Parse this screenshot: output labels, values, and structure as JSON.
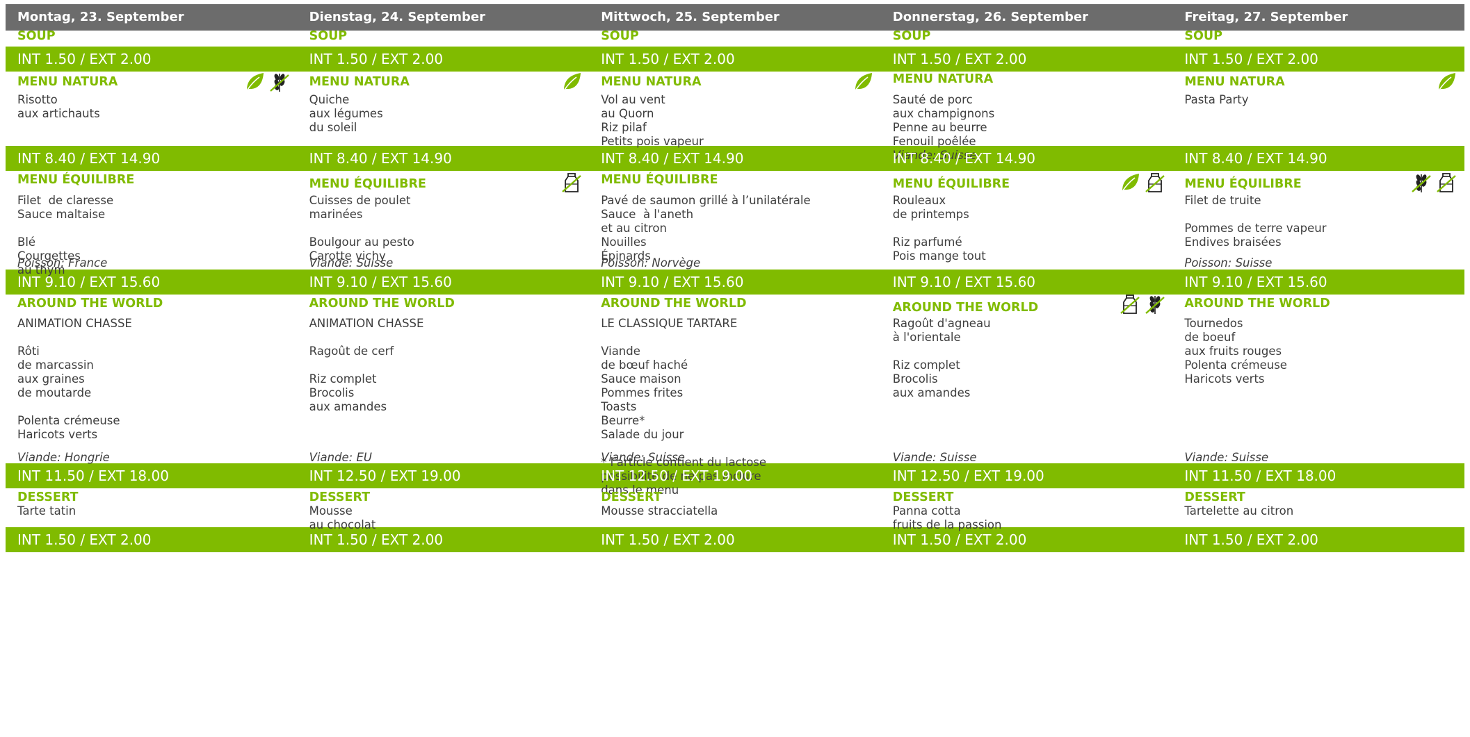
{
  "days": [
    {
      "header": "Montag, 23. September",
      "soup": {
        "title": "SOUP",
        "price": "INT 1.50 / EXT 2.00"
      },
      "natura": {
        "title": "MENU NATURA",
        "lines": [
          "Risotto",
          "aux artichauts"
        ],
        "origin": "",
        "price": "INT 8.40 / EXT 14.90",
        "icons": [
          "leaf-icon",
          "gluten-free-icon"
        ]
      },
      "equilibre": {
        "title": "MENU ÉQUILIBRE",
        "lines": [
          "Filet  de claresse",
          "Sauce maltaise",
          "",
          "Blé",
          "Courgettes",
          "au thym"
        ],
        "origin": "Poisson: France",
        "price": "INT 9.10 / EXT 15.60",
        "icons": []
      },
      "world": {
        "title": "AROUND THE WORLD",
        "lines": [
          "ANIMATION CHASSE",
          "",
          "Rôti",
          "de marcassin",
          "aux graines",
          "de moutarde",
          "",
          "Polenta crémeuse",
          "Haricots verts"
        ],
        "origin": "Viande: Hongrie",
        "price": "INT 11.50 / EXT 18.00",
        "icons": []
      },
      "dessert": {
        "title": "DESSERT",
        "lines": [
          "Tarte tatin"
        ],
        "price": "INT 1.50 / EXT 2.00"
      }
    },
    {
      "header": "Dienstag, 24. September",
      "soup": {
        "title": "SOUP",
        "price": "INT 1.50 / EXT 2.00"
      },
      "natura": {
        "title": "MENU NATURA",
        "lines": [
          "Quiche",
          "aux légumes",
          "du soleil"
        ],
        "origin": "",
        "price": "INT 8.40 / EXT 14.90",
        "icons": [
          "leaf-icon"
        ]
      },
      "equilibre": {
        "title": "MENU ÉQUILIBRE",
        "lines": [
          "Cuisses de poulet",
          "marinées",
          "",
          "Boulgour au pesto",
          "Carotte vichy"
        ],
        "origin": "Viande: Suisse",
        "price": "INT 9.10 / EXT 15.60",
        "icons": [
          "lactose-free-icon"
        ]
      },
      "world": {
        "title": "AROUND THE WORLD",
        "lines": [
          "ANIMATION CHASSE",
          "",
          "Ragoût de cerf",
          "",
          "Riz complet",
          "Brocolis",
          "aux amandes"
        ],
        "origin": "Viande: EU",
        "price": "INT 12.50 / EXT 19.00",
        "icons": []
      },
      "dessert": {
        "title": "DESSERT",
        "lines": [
          "Mousse",
          "au chocolat"
        ],
        "price": "INT 1.50 / EXT 2.00"
      }
    },
    {
      "header": "Mittwoch, 25. September",
      "soup": {
        "title": "SOUP",
        "price": "INT 1.50 / EXT 2.00"
      },
      "natura": {
        "title": "MENU NATURA",
        "lines": [
          "Vol au vent",
          "au Quorn",
          "Riz pilaf",
          "Petits pois vapeur"
        ],
        "origin": "",
        "price": "INT 8.40 / EXT 14.90",
        "icons": [
          "leaf-icon"
        ]
      },
      "equilibre": {
        "title": "MENU ÉQUILIBRE",
        "lines": [
          "Pavé de saumon grillé à l’unilatérale",
          "Sauce  à l'aneth",
          "et au citron",
          "Nouilles",
          "Épinards"
        ],
        "origin": "Poisson: Norvège",
        "price": "INT 9.10 / EXT 15.60",
        "icons": []
      },
      "world": {
        "title": "AROUND THE WORLD",
        "lines": [
          "LE CLASSIQUE TARTARE",
          "",
          "Viande",
          "de bœuf haché",
          "Sauce maison",
          "Pommes frites",
          "Toasts",
          "Beurre*",
          "Salade du jour",
          "",
          "* l'article contient du lactose",
          "possibilité de ne pas inclure",
          "dans le menu"
        ],
        "origin": "Viande: Suisse",
        "price": "INT 12.50 / EXT 19.00",
        "icons": []
      },
      "dessert": {
        "title": "DESSERT",
        "lines": [
          "Mousse stracciatella"
        ],
        "price": "INT 1.50 / EXT 2.00"
      }
    },
    {
      "header": "Donnerstag, 26. September",
      "soup": {
        "title": "SOUP",
        "price": "INT 1.50 / EXT 2.00"
      },
      "natura": {
        "title": "MENU NATURA",
        "lines": [
          "Sauté de porc",
          "aux champignons",
          "Penne au beurre",
          "Fenouil poêlée"
        ],
        "origin": "Viande: Suisse",
        "price": "INT 8.40 / EXT 14.90",
        "icons": []
      },
      "equilibre": {
        "title": "MENU ÉQUILIBRE",
        "lines": [
          "Rouleaux",
          "de printemps",
          "",
          "Riz parfumé",
          "Pois mange tout"
        ],
        "origin": "",
        "price": "INT 9.10 / EXT 15.60",
        "icons": [
          "leaf-icon",
          "lactose-free-icon"
        ]
      },
      "world": {
        "title": "AROUND THE WORLD",
        "lines": [
          "Ragoût d'agneau",
          "à l'orientale",
          "",
          "Riz complet",
          "Brocolis",
          "aux amandes"
        ],
        "origin": "Viande: Suisse",
        "price": "INT 12.50 / EXT 19.00",
        "icons": [
          "lactose-free-icon",
          "gluten-free-icon"
        ]
      },
      "dessert": {
        "title": "DESSERT",
        "lines": [
          "Panna cotta",
          "fruits de la passion"
        ],
        "price": "INT 1.50 / EXT 2.00"
      }
    },
    {
      "header": "Freitag, 27. September",
      "soup": {
        "title": "SOUP",
        "price": "INT 1.50 / EXT 2.00"
      },
      "natura": {
        "title": "MENU NATURA",
        "lines": [
          "Pasta Party"
        ],
        "origin": "",
        "price": "INT 8.40 / EXT 14.90",
        "icons": [
          "leaf-icon"
        ]
      },
      "equilibre": {
        "title": "MENU ÉQUILIBRE",
        "lines": [
          "Filet de truite",
          "",
          "Pommes de terre vapeur",
          "Endives braisées"
        ],
        "origin": "Poisson: Suisse",
        "price": "INT 9.10 / EXT 15.60",
        "icons": [
          "gluten-free-icon",
          "lactose-free-icon"
        ]
      },
      "world": {
        "title": "AROUND THE WORLD",
        "lines": [
          "Tournedos",
          "de boeuf",
          "aux fruits rouges",
          "Polenta crémeuse",
          "Haricots verts"
        ],
        "origin": "Viande: Suisse",
        "price": "INT 11.50 / EXT 18.00",
        "icons": []
      },
      "dessert": {
        "title": "DESSERT",
        "lines": [
          "Tartelette au citron"
        ],
        "price": "INT 1.50 / EXT 2.00"
      }
    }
  ],
  "colors": {
    "header_bg": "#6c6c6c",
    "band_bg": "#80bb00",
    "title_green": "#80bb00",
    "text": "#3e3e3e"
  }
}
